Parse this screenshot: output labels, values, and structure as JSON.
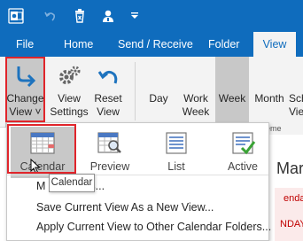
{
  "qat": {
    "icons": [
      "outlook-app-icon",
      "undo-icon",
      "delete-icon",
      "contacts-icon",
      "customize-qat-icon"
    ]
  },
  "tabs": [
    "File",
    "Home",
    "Send / Receive",
    "Folder",
    "View"
  ],
  "active_tab": "View",
  "ribbon": {
    "change_view": [
      "Change",
      "View ˅"
    ],
    "view_settings": [
      "View",
      "Settings"
    ],
    "reset_view": [
      "Reset",
      "View"
    ],
    "day": [
      "Day",
      ""
    ],
    "work_week": [
      "Work",
      "Week"
    ],
    "week": [
      "Week",
      ""
    ],
    "month": [
      "Month",
      ""
    ],
    "schedule": [
      "Sch",
      "Vie"
    ]
  },
  "views": [
    "Calendar",
    "Preview",
    "List",
    "Active"
  ],
  "menu": {
    "manage": "Manage Views...",
    "manage_visible": "M",
    "manage_tail": "s...",
    "save": "Save Current View As a New View...",
    "apply": "Apply Current View to Other Calendar Folders..."
  },
  "tooltip": "Calendar",
  "background": {
    "strip_text": "eme",
    "date_fragment": "Mar",
    "red_fragment_1": "endar",
    "red_fragment_2": "NDAY"
  },
  "colors": {
    "accent": "#0f6cbd",
    "highlight": "#e0252b",
    "selected_button": "#c8c8c8"
  }
}
